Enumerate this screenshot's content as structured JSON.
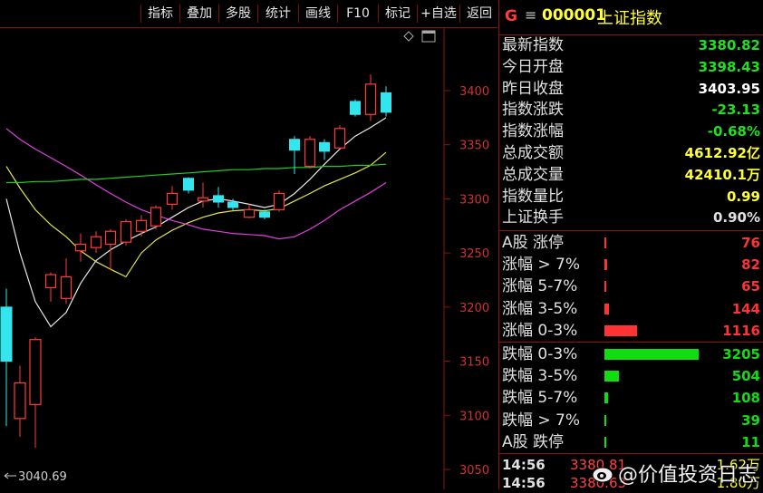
{
  "toolbar": {
    "buttons": [
      "指标",
      "叠加",
      "多股",
      "统计",
      "画线",
      "F10",
      "标记",
      "+自选",
      "返回"
    ]
  },
  "chart": {
    "low_marker": "3040.69",
    "diamond_icon": "diamond-icon",
    "window_icon": "window-icon"
  },
  "chart_data": {
    "type": "candlestick",
    "ylim": [
      3040,
      3470
    ],
    "yticks": [
      3050,
      3100,
      3150,
      3200,
      3250,
      3300,
      3350,
      3400
    ],
    "candles": [
      {
        "o": 3200,
        "c": 3150,
        "h": 3217,
        "l": 3090
      },
      {
        "o": 3097,
        "c": 3130,
        "h": 3146,
        "l": 3080
      },
      {
        "o": 3110,
        "c": 3170,
        "h": 3172,
        "l": 3070
      },
      {
        "o": 3218,
        "c": 3230,
        "h": 3232,
        "l": 3205
      },
      {
        "o": 3208,
        "c": 3228,
        "h": 3245,
        "l": 3203
      },
      {
        "o": 3252,
        "c": 3258,
        "h": 3268,
        "l": 3242
      },
      {
        "o": 3255,
        "c": 3265,
        "h": 3270,
        "l": 3250
      },
      {
        "o": 3258,
        "c": 3270,
        "h": 3272,
        "l": 3234
      },
      {
        "o": 3260,
        "c": 3279,
        "h": 3281,
        "l": 3257
      },
      {
        "o": 3270,
        "c": 3280,
        "h": 3285,
        "l": 3265
      },
      {
        "o": 3275,
        "c": 3292,
        "h": 3294,
        "l": 3272
      },
      {
        "o": 3295,
        "c": 3305,
        "h": 3312,
        "l": 3290
      },
      {
        "o": 3319,
        "c": 3308,
        "h": 3320,
        "l": 3305
      },
      {
        "o": 3298,
        "c": 3301,
        "h": 3315,
        "l": 3292
      },
      {
        "o": 3303,
        "c": 3297,
        "h": 3311,
        "l": 3292
      },
      {
        "o": 3297,
        "c": 3292,
        "h": 3300,
        "l": 3289
      },
      {
        "o": 3283,
        "c": 3290,
        "h": 3295,
        "l": 3282
      },
      {
        "o": 3288,
        "c": 3283,
        "h": 3290,
        "l": 3281
      },
      {
        "o": 3290,
        "c": 3305,
        "h": 3308,
        "l": 3288
      },
      {
        "o": 3355,
        "c": 3345,
        "h": 3358,
        "l": 3323
      },
      {
        "o": 3330,
        "c": 3355,
        "h": 3358,
        "l": 3328
      },
      {
        "o": 3352,
        "c": 3344,
        "h": 3355,
        "l": 3336
      },
      {
        "o": 3347,
        "c": 3365,
        "h": 3368,
        "l": 3346
      },
      {
        "o": 3390,
        "c": 3378,
        "h": 3392,
        "l": 3376
      },
      {
        "o": 3378,
        "c": 3406,
        "h": 3415,
        "l": 3372
      },
      {
        "o": 3398,
        "c": 3380,
        "h": 3404,
        "l": 3376
      }
    ],
    "ma_series": [
      {
        "color": "#e8e8e8",
        "values": [
          3300,
          3250,
          3205,
          3182,
          3195,
          3222,
          3243,
          3253,
          3261,
          3268,
          3274,
          3283,
          3292,
          3298,
          3300,
          3298,
          3295,
          3292,
          3295,
          3305,
          3318,
          3332,
          3346,
          3358,
          3366,
          3375
        ]
      },
      {
        "color": "#e6e644",
        "values": [
          3330,
          3310,
          3290,
          3276,
          3265,
          3252,
          3242,
          3235,
          3228,
          3250,
          3262,
          3271,
          3278,
          3283,
          3287,
          3289,
          3290,
          3289,
          3291,
          3298,
          3305,
          3312,
          3318,
          3324,
          3331,
          3343
        ]
      },
      {
        "color": "#e040e0",
        "values": [
          3365,
          3355,
          3346,
          3338,
          3330,
          3322,
          3313,
          3305,
          3297,
          3290,
          3285,
          3280,
          3276,
          3272,
          3270,
          3268,
          3267,
          3266,
          3263,
          3265,
          3272,
          3280,
          3290,
          3298,
          3306,
          3315
        ]
      },
      {
        "color": "#22cc22",
        "values": [
          3315,
          3315,
          3316,
          3316,
          3317,
          3318,
          3318,
          3319,
          3320,
          3321,
          3322,
          3323,
          3324,
          3325,
          3326,
          3327,
          3327,
          3328,
          3328,
          3329,
          3329,
          3330,
          3330,
          3331,
          3331,
          3332
        ]
      }
    ]
  },
  "quote": {
    "g_label": "G",
    "menu_icon": "menu-icon",
    "code": "000001",
    "name": "上证指数",
    "rows": [
      {
        "label": "最新指数",
        "value": "3380.82",
        "color": "#22dd22"
      },
      {
        "label": "今日开盘",
        "value": "3398.43",
        "color": "#22dd22"
      },
      {
        "label": "昨日收盘",
        "value": "3403.95",
        "color": "#ffffff"
      },
      {
        "label": "指数涨跌",
        "value": "-23.13",
        "color": "#22dd22"
      },
      {
        "label": "指数涨幅",
        "value": "-0.68%",
        "color": "#22dd22"
      },
      {
        "label": "总成交额",
        "value": "4612.92亿",
        "color": "#ffff33"
      },
      {
        "label": "总成交量",
        "value": "42410.1万",
        "color": "#ffff33"
      },
      {
        "label": "指数量比",
        "value": "0.99",
        "color": "#ffff33"
      },
      {
        "label": "上证换手",
        "value": "0.90%",
        "color": "#e0e0e0"
      }
    ]
  },
  "breadth": {
    "up": [
      {
        "label": "A股 涨停",
        "value": "76",
        "frac": 0.006
      },
      {
        "label": "涨幅 > 7%",
        "value": "82",
        "frac": 0.026
      },
      {
        "label": "涨幅 5-7%",
        "value": "65",
        "frac": 0.006
      },
      {
        "label": "涨幅 3-5%",
        "value": "144",
        "frac": 0.045
      },
      {
        "label": "涨幅 0-3%",
        "value": "1116",
        "frac": 0.348
      }
    ],
    "down": [
      {
        "label": "跌幅 0-3%",
        "value": "3205",
        "frac": 1.0
      },
      {
        "label": "跌幅 3-5%",
        "value": "504",
        "frac": 0.157
      },
      {
        "label": "跌幅 5-7%",
        "value": "108",
        "frac": 0.034
      },
      {
        "label": "跌幅 > 7%",
        "value": "39",
        "frac": 0.012
      },
      {
        "label": "A股 跌停",
        "value": "11",
        "frac": 0.006
      }
    ],
    "up_color": "#ff3333",
    "down_color": "#11dd11"
  },
  "ticks": [
    {
      "time": "14:56",
      "price": "3380.81",
      "vol": "1.62万"
    },
    {
      "time": "14:56",
      "price": "3380.63",
      "vol": "1.80万"
    }
  ],
  "watermark": "@价值投资日志"
}
